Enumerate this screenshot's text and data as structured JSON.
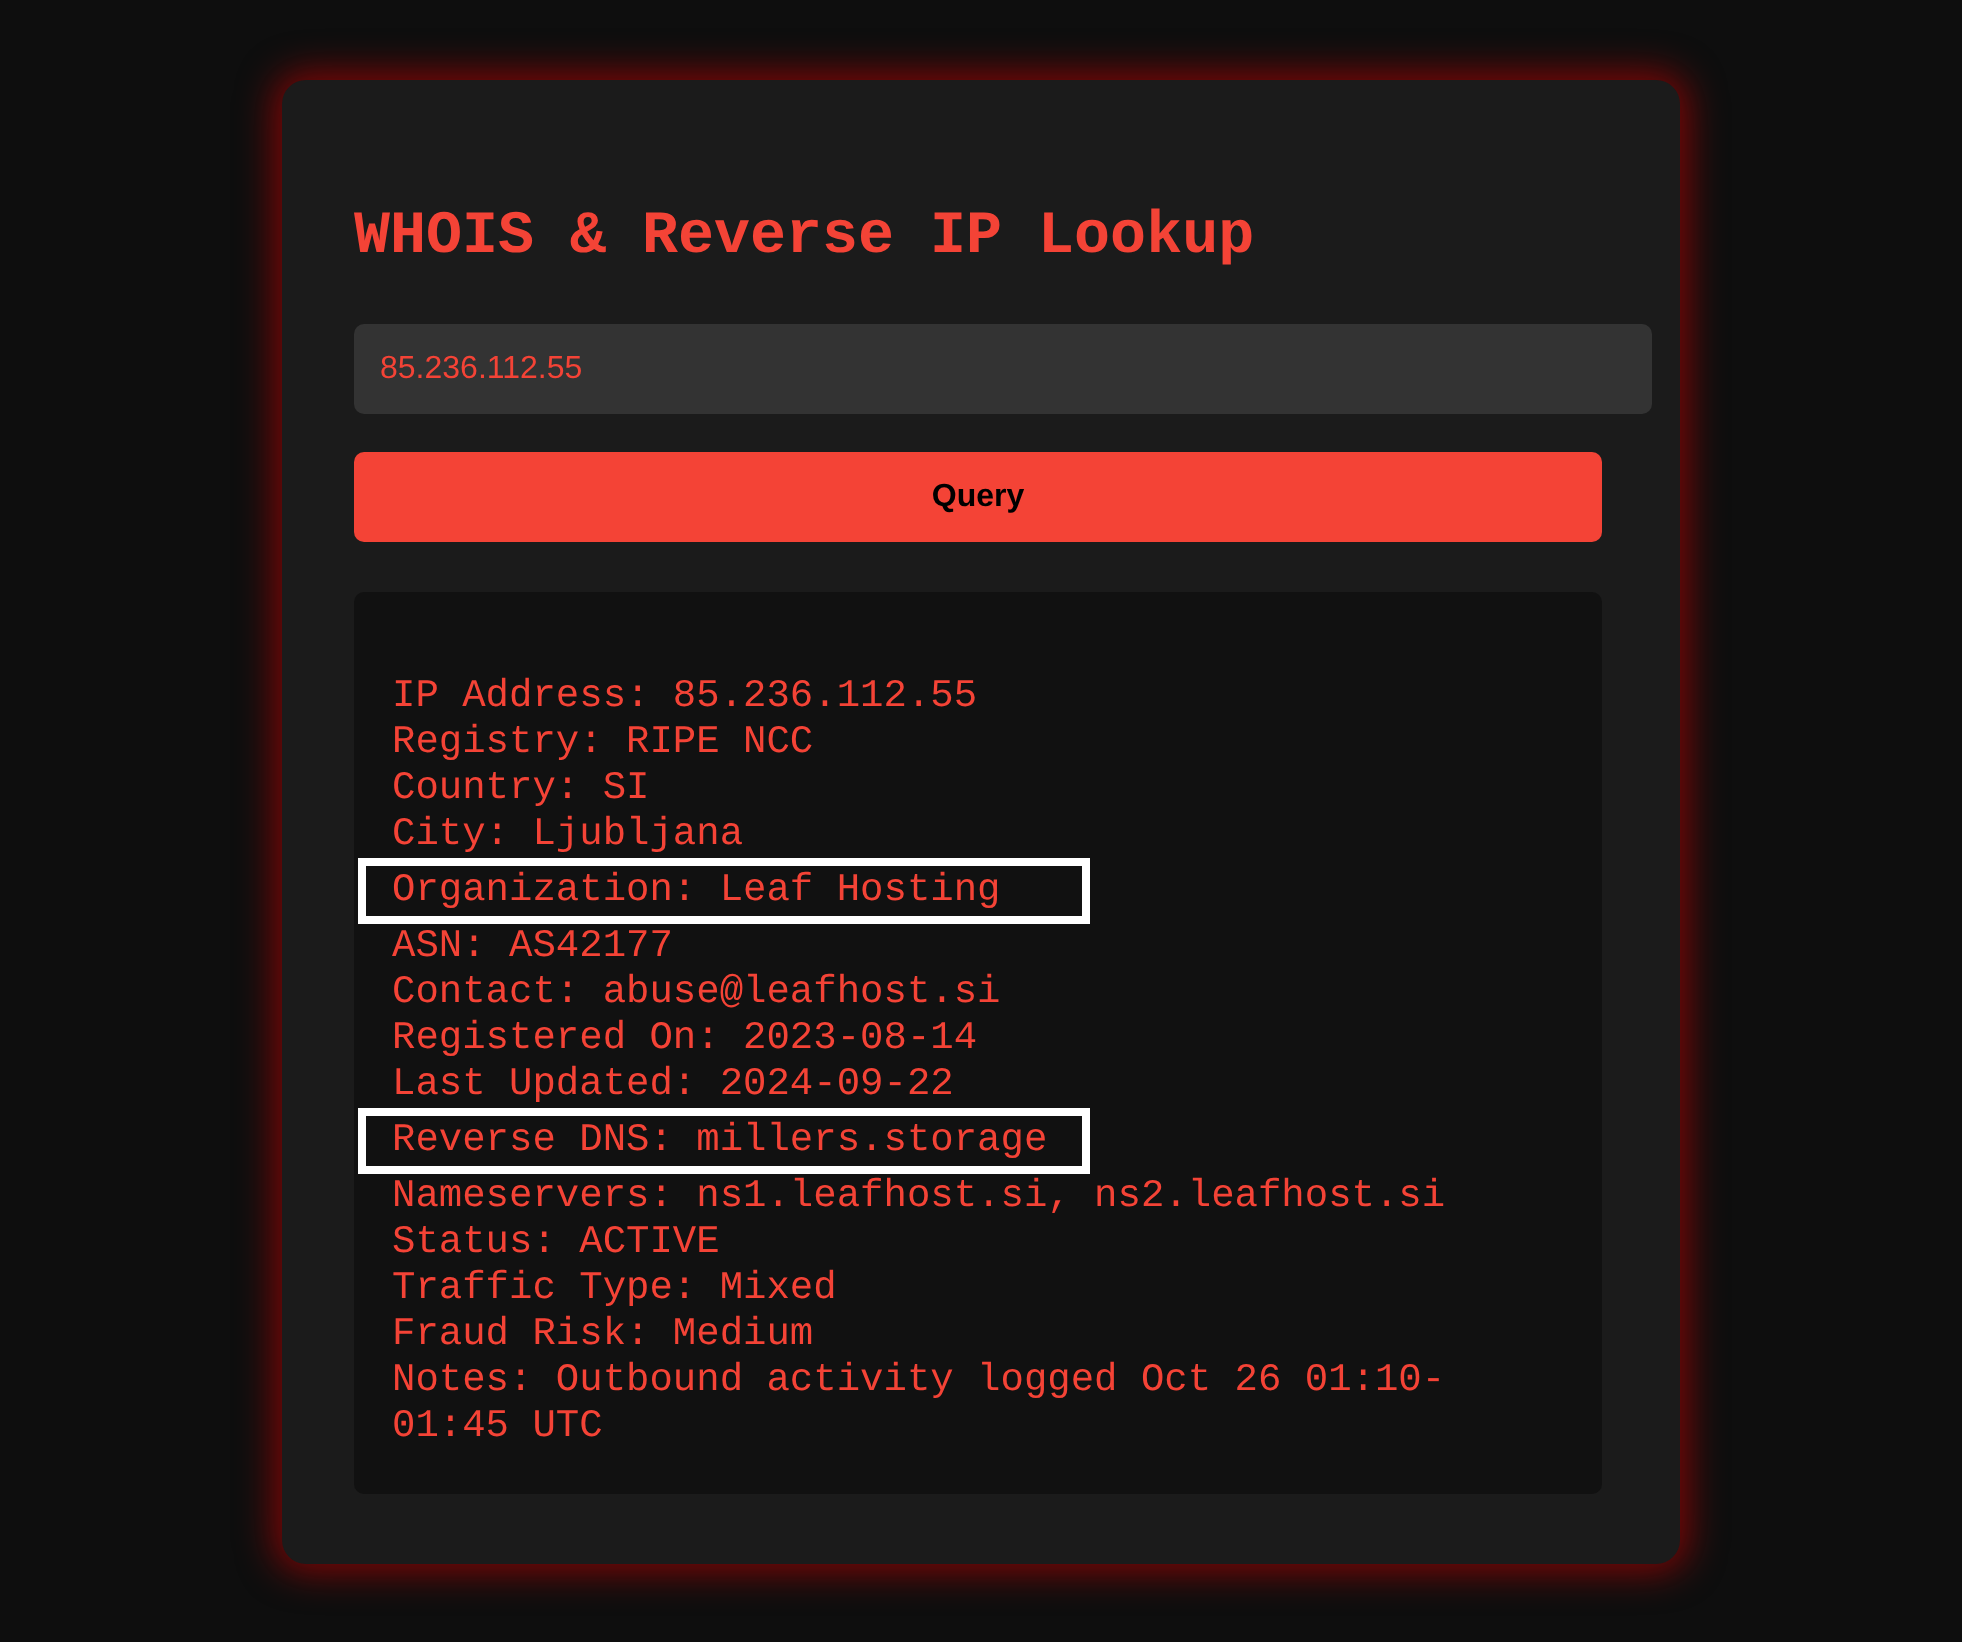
{
  "title": "WHOIS & Reverse IP Lookup",
  "search": {
    "value": "85.236.112.55"
  },
  "button": "Query",
  "results": [
    {
      "text": "IP Address: 85.236.112.55",
      "highlighted": false
    },
    {
      "text": "Registry: RIPE NCC",
      "highlighted": false
    },
    {
      "text": "Country: SI",
      "highlighted": false
    },
    {
      "text": "City: Ljubljana",
      "highlighted": false
    },
    {
      "text": "Organization: Leaf Hosting",
      "highlighted": true
    },
    {
      "text": "ASN: AS42177",
      "highlighted": false
    },
    {
      "text": "Contact: abuse@leafhost.si",
      "highlighted": false
    },
    {
      "text": "Registered On: 2023-08-14",
      "highlighted": false
    },
    {
      "text": "Last Updated: 2024-09-22",
      "highlighted": false
    },
    {
      "text": "Reverse DNS: millers.storage",
      "highlighted": true
    },
    {
      "text": "Nameservers: ns1.leafhost.si, ns2.leafhost.si",
      "highlighted": false
    },
    {
      "text": "Status: ACTIVE",
      "highlighted": false
    },
    {
      "text": "Traffic Type: Mixed",
      "highlighted": false
    },
    {
      "text": "Fraud Risk: Medium",
      "highlighted": false
    },
    {
      "text": "Notes: Outbound activity logged Oct 26 01:10-01:45 UTC",
      "highlighted": false
    }
  ]
}
